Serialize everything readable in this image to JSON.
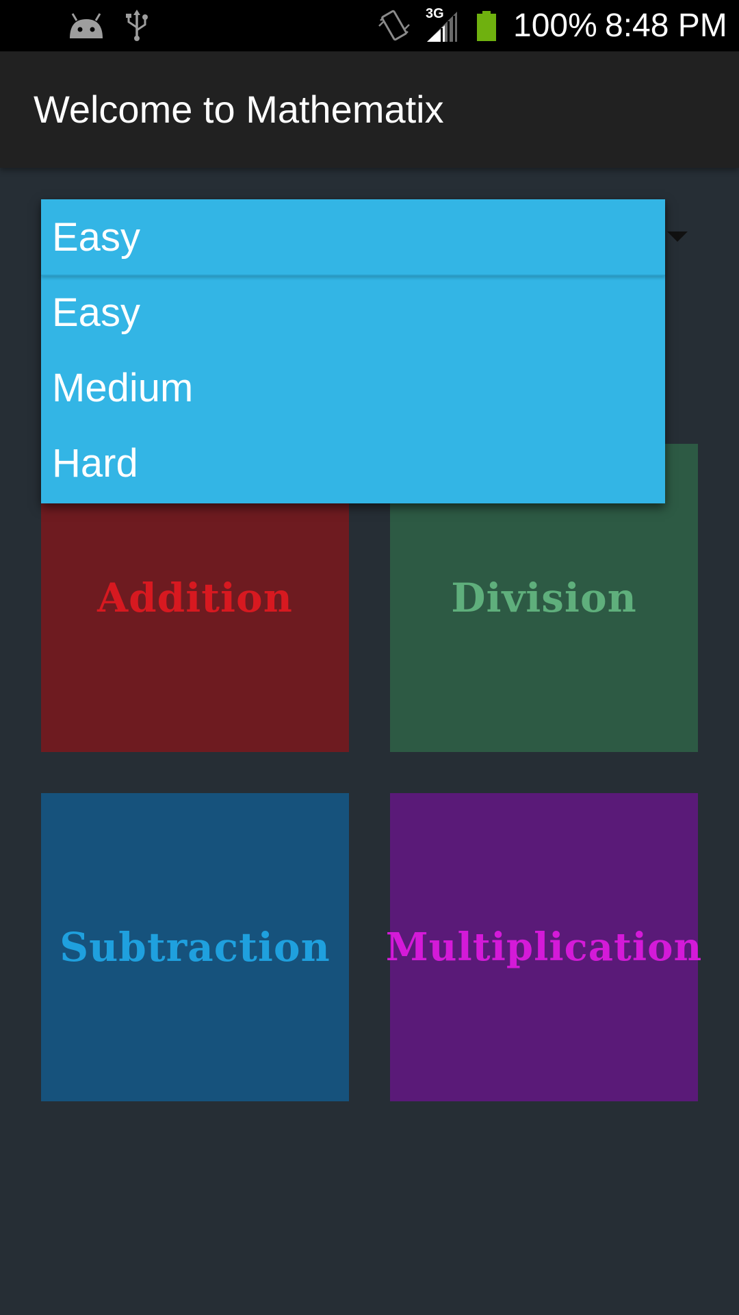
{
  "status_bar": {
    "icons": [
      "android-debug-icon",
      "usb-icon",
      "vibrate-icon",
      "signal-3g-icon",
      "battery-icon"
    ],
    "network_label": "3G",
    "battery": "100%",
    "time": "8:48 PM"
  },
  "app_bar": {
    "title": "Welcome to Mathematix"
  },
  "difficulty_spinner": {
    "selected": "Easy",
    "options": [
      "Easy",
      "Medium",
      "Hard"
    ]
  },
  "tiles": [
    {
      "label": "Addition",
      "bg": "#6e1b20",
      "fg": "#d71920"
    },
    {
      "label": "Division",
      "bg": "#2d5a44",
      "fg": "#5faf7c"
    },
    {
      "label": "Subtraction",
      "bg": "#16527c",
      "fg": "#1fa0de"
    },
    {
      "label": "Multiplication",
      "bg": "#5a1a78",
      "fg": "#d41ad8"
    }
  ],
  "colors": {
    "background": "#262e35",
    "app_bar": "#212121",
    "accent": "#33b5e5",
    "battery": "#6fb10f"
  }
}
